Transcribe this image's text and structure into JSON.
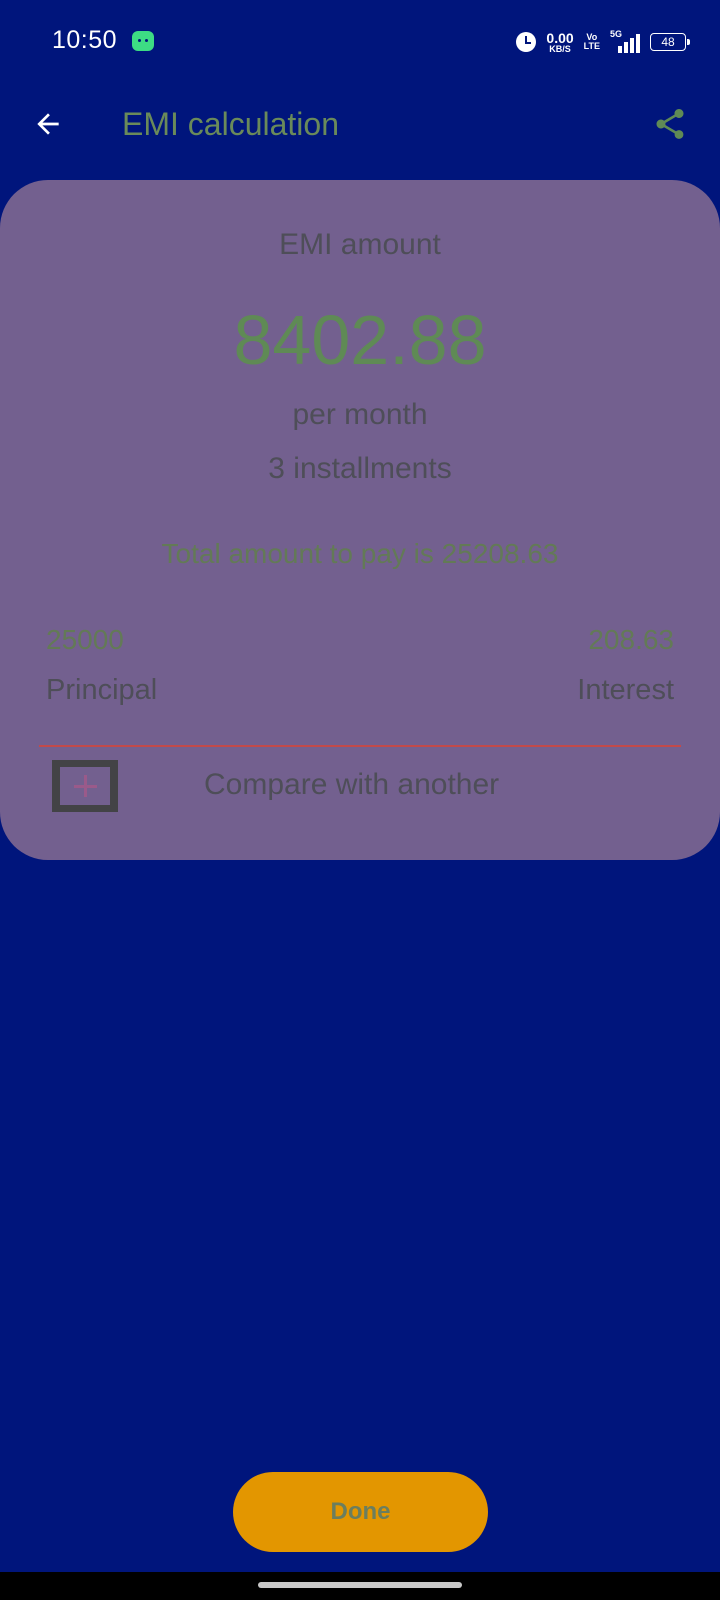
{
  "status_bar": {
    "time": "10:50",
    "net_speed_value": "0.00",
    "net_speed_unit": "KB/S",
    "volte_top": "Vo",
    "volte_bottom": "LTE",
    "network_type": "5G",
    "battery_level": "48",
    "icons": [
      "android-app-icon",
      "alarm-icon",
      "signal-icon",
      "battery-icon"
    ]
  },
  "toolbar": {
    "title": "EMI calculation",
    "back_icon": "arrow-left-icon",
    "share_icon": "share-icon"
  },
  "result": {
    "emi_label": "EMI amount",
    "emi_value": "8402.88",
    "per_month": "per month",
    "installments": "3 installments",
    "total_text": "Total amount to pay is 25208.63",
    "principal_value": "25000",
    "principal_label": "Principal",
    "interest_value": "208.63",
    "interest_label": "Interest",
    "compare_label": "Compare with another",
    "compare_icon": "add-box-icon"
  },
  "footer": {
    "done_label": "Done"
  },
  "colors": {
    "background": "#00157C",
    "card": "#73608F",
    "accent_text": "#5f8a55",
    "divider": "#c24a4a",
    "done_button": "#E39600"
  }
}
